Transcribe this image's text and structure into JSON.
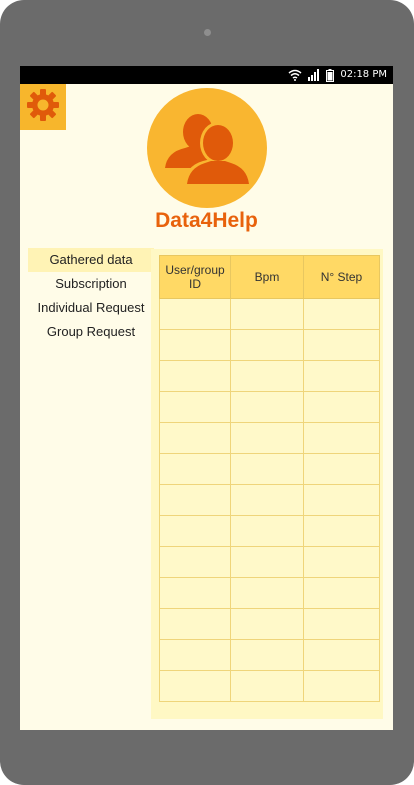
{
  "status_bar": {
    "time": "02:18 PM",
    "icons": [
      "wifi-icon",
      "signal-icon",
      "battery-icon"
    ]
  },
  "app": {
    "title": "Data4Help",
    "settings_icon": "gear-icon",
    "avatar_icon": "users-icon"
  },
  "nav": {
    "items": [
      {
        "label": "Gathered data",
        "active": true
      },
      {
        "label": "Subscription",
        "active": false
      },
      {
        "label": "Individual Request",
        "active": false
      },
      {
        "label": "Group Request",
        "active": false
      }
    ]
  },
  "table": {
    "columns": [
      "User/group ID",
      "Bpm",
      "N° Step"
    ],
    "rows": [
      [
        "",
        "",
        ""
      ],
      [
        "",
        "",
        ""
      ],
      [
        "",
        "",
        ""
      ],
      [
        "",
        "",
        ""
      ],
      [
        "",
        "",
        ""
      ],
      [
        "",
        "",
        ""
      ],
      [
        "",
        "",
        ""
      ],
      [
        "",
        "",
        ""
      ],
      [
        "",
        "",
        ""
      ],
      [
        "",
        "",
        ""
      ],
      [
        "",
        "",
        ""
      ],
      [
        "",
        "",
        ""
      ],
      [
        "",
        "",
        ""
      ]
    ]
  },
  "colors": {
    "accent": "#e8620c",
    "amber": "#f9b630",
    "background": "#fffce8",
    "header_cell": "#ffd965",
    "panel": "#fff8c4",
    "nav_active": "#fff3b5"
  }
}
